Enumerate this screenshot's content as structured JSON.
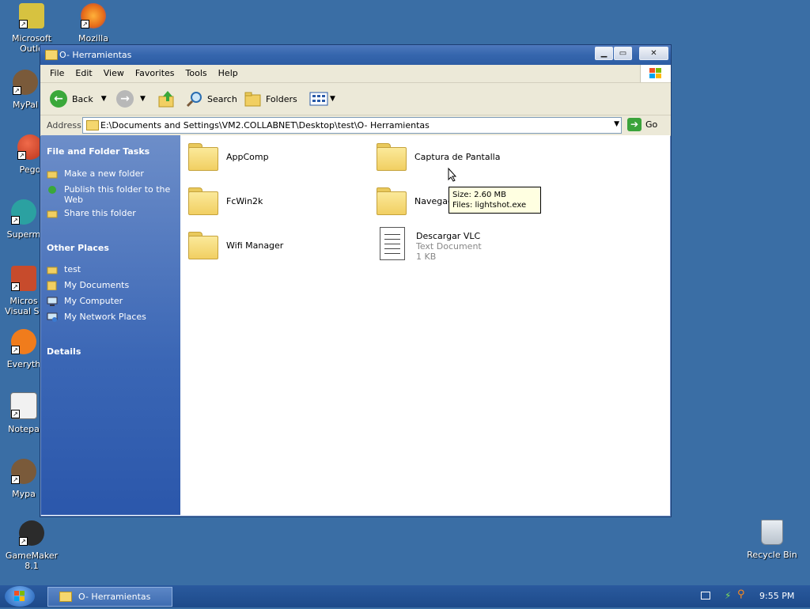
{
  "desktop": {
    "icons": [
      {
        "label": "Microsoft\nOutlo",
        "icon": "outlook-icon",
        "color": "#d7c240"
      },
      {
        "label": "Mozilla\nFirefox",
        "icon": "firefox-icon",
        "color": "#e66a18"
      },
      {
        "label": "MyPal",
        "icon": "mypal-icon",
        "color": "#7a5a3a"
      },
      {
        "label": "Pego",
        "icon": "pego-icon",
        "color": "#b9341c"
      },
      {
        "label": "Superm",
        "icon": "superm-icon",
        "color": "#2ba1a1"
      },
      {
        "label": "Micros\nVisual St",
        "icon": "visual-studio-icon",
        "color": "#c74b2c"
      },
      {
        "label": "Everyth",
        "icon": "everything-icon",
        "color": "#f07c1c"
      },
      {
        "label": "Notepa",
        "icon": "notepad-icon",
        "color": "#f1f1f1"
      },
      {
        "label": "Mypa",
        "icon": "mypal2-icon",
        "color": "#7a5a3a"
      },
      {
        "label": "GameMaker\n8.1",
        "icon": "gamemaker-icon",
        "color": "#2b2b2b"
      }
    ],
    "recycle_bin": "Recycle Bin"
  },
  "window": {
    "title": "O- Herramientas",
    "menu": [
      "File",
      "Edit",
      "View",
      "Favorites",
      "Tools",
      "Help"
    ],
    "toolbar": {
      "back": "Back",
      "search": "Search",
      "folders": "Folders"
    },
    "address": {
      "label": "Address",
      "path": "E:\\Documents and Settings\\VM2.COLLABNET\\Desktop\\test\\O- Herramientas",
      "go": "Go"
    },
    "side": {
      "tasks_title": "File and Folder Tasks",
      "tasks": [
        "Make a new folder",
        "Publish this folder to the Web",
        "Share this folder"
      ],
      "other_title": "Other Places",
      "other": [
        "test",
        "My Documents",
        "My Computer",
        "My Network Places"
      ],
      "details_title": "Details"
    },
    "items": [
      {
        "name": "AppComp",
        "type": "folder"
      },
      {
        "name": "Captura de Pantalla",
        "type": "folder"
      },
      {
        "name": "FcWin2k",
        "type": "folder"
      },
      {
        "name": "Navegad",
        "type": "folder"
      },
      {
        "name": "Wifi Manager",
        "type": "folder"
      },
      {
        "name": "Descargar VLC",
        "type": "file",
        "subtype": "Text Document",
        "size": "1 KB"
      }
    ],
    "tooltip": {
      "size": "Size: 2.60 MB",
      "files": "Files: lightshot.exe"
    }
  },
  "taskbar": {
    "task": "O- Herramientas",
    "time": "9:55 PM"
  }
}
